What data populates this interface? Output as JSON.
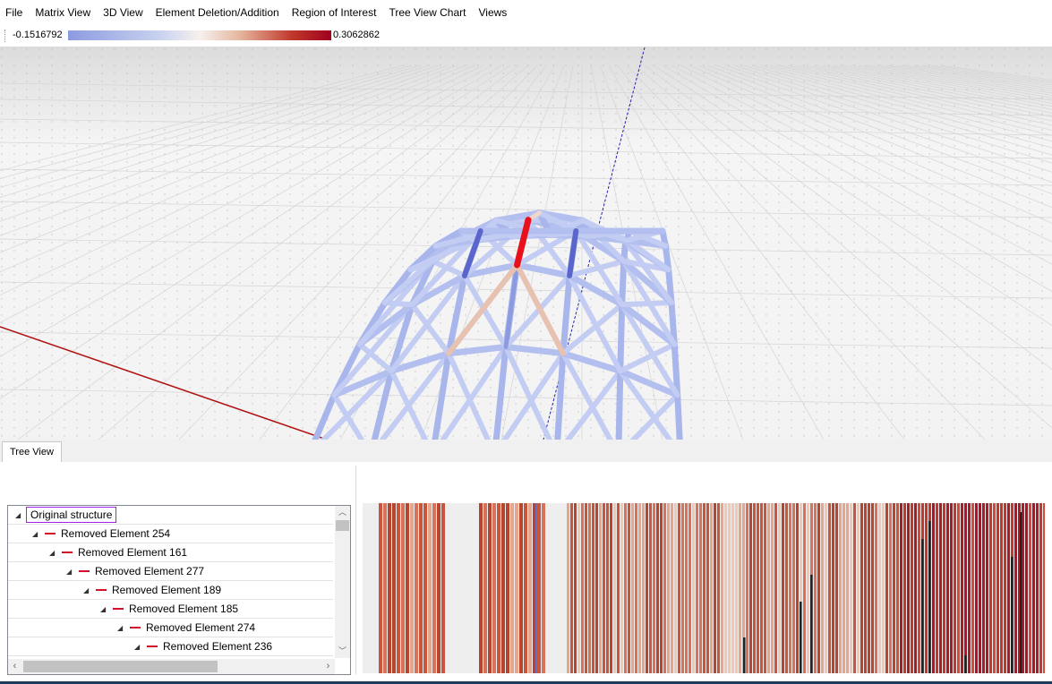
{
  "menu": [
    "File",
    "Matrix View",
    "3D View",
    "Element Deletion/Addition",
    "Region of Interest",
    "Tree View Chart",
    "Views"
  ],
  "legend": {
    "min_label": "-0.1516792",
    "max_label": "0.3062862"
  },
  "tabs": [
    {
      "label": "Tree View",
      "active": true
    }
  ],
  "tree": {
    "root": "Original structure",
    "items": [
      {
        "label": "Removed Element 254",
        "depth": 1
      },
      {
        "label": "Removed Element 161",
        "depth": 2
      },
      {
        "label": "Removed Element 277",
        "depth": 3
      },
      {
        "label": "Removed Element 189",
        "depth": 4
      },
      {
        "label": "Removed Element 185",
        "depth": 5
      },
      {
        "label": "Removed Element 274",
        "depth": 6
      },
      {
        "label": "Removed Element 236",
        "depth": 7
      }
    ]
  },
  "colors": {
    "accent_red": "#e8101a",
    "element_low": "#8c9be0",
    "element_neutral": "#f6f1ee",
    "element_high": "#a0001e",
    "axis_x": "#b01010",
    "axis_z": "#2222aa",
    "tree_root_border": "#a020f0"
  },
  "icons": {
    "expand": "expanded-triangle-icon",
    "removed": "red-dash-icon",
    "scroll_up": "chevron-up-icon",
    "scroll_down": "chevron-down-icon",
    "scroll_left": "chevron-left-icon",
    "scroll_right": "chevron-right-icon"
  }
}
